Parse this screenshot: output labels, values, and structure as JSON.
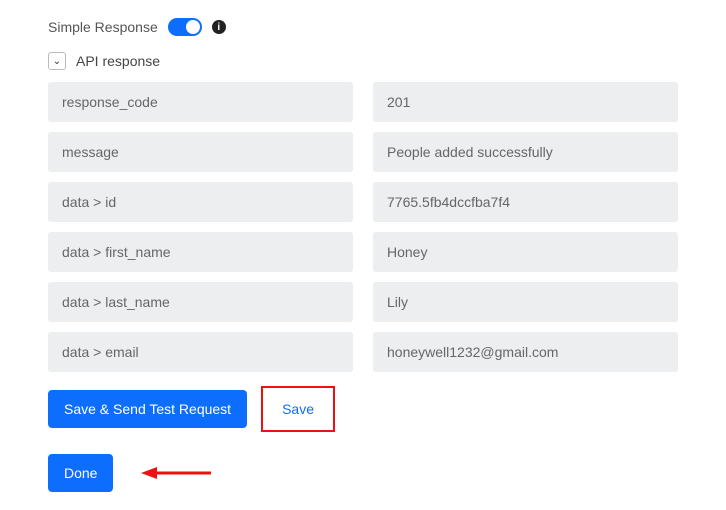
{
  "header": {
    "title": "Simple Response",
    "toggle_on": true,
    "info_glyph": "i"
  },
  "section": {
    "title": "API response",
    "chevron_glyph": "⌄"
  },
  "fields": [
    {
      "key": "response_code",
      "value": "201"
    },
    {
      "key": "message",
      "value": "People added successfully"
    },
    {
      "key": "data > id",
      "value": "7765.5fb4dccfba7f4"
    },
    {
      "key": "data > first_name",
      "value": "Honey"
    },
    {
      "key": "data > last_name",
      "value": "Lily"
    },
    {
      "key": "data > email",
      "value": "honeywell1232@gmail.com"
    }
  ],
  "buttons": {
    "save_send": "Save & Send Test Request",
    "save": "Save",
    "done": "Done"
  },
  "colors": {
    "accent": "#0d6efd",
    "highlight": "#e11"
  }
}
